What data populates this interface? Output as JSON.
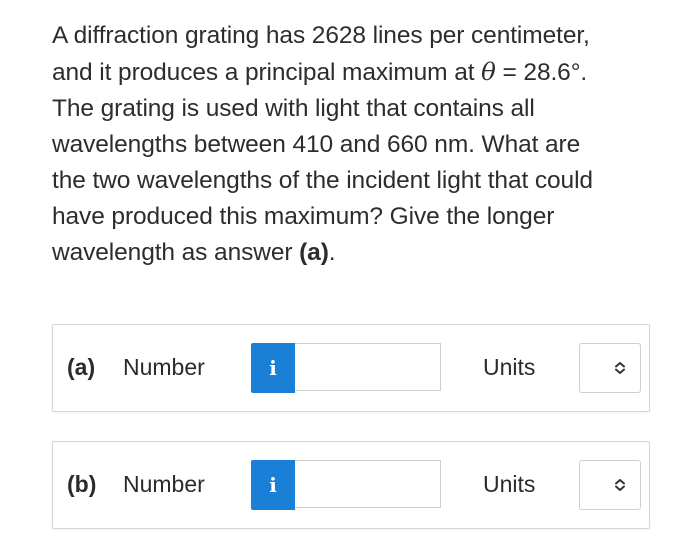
{
  "question": {
    "line1": "A diffraction grating has 2628 lines per centimeter,",
    "line2_pre": "and it produces a principal maximum at ",
    "theta_symbol": "θ",
    "line2_post": " = 28.6°.",
    "line3": "The grating is used with light that contains all",
    "line4": "wavelengths between 410 and 660 nm. What are",
    "line5": "the two wavelengths of the incident light that could",
    "line6": "have produced this maximum? Give the longer",
    "line7_pre": "wavelength as answer ",
    "line7_bold": "(a)",
    "line7_post": "."
  },
  "answers": [
    {
      "part_label": "(a)",
      "number_label": "Number",
      "info_glyph": "i",
      "number_value": "",
      "units_label": "Units",
      "units_selected": ""
    },
    {
      "part_label": "(b)",
      "number_label": "Number",
      "info_glyph": "i",
      "number_value": "",
      "units_label": "Units",
      "units_selected": ""
    }
  ],
  "colors": {
    "info_button": "#1a7fd6",
    "text": "#2b2b2b",
    "border": "#d6d6d6"
  },
  "icons": {
    "info": "info-icon",
    "units_dropdown": "chevron-up-down-icon"
  }
}
